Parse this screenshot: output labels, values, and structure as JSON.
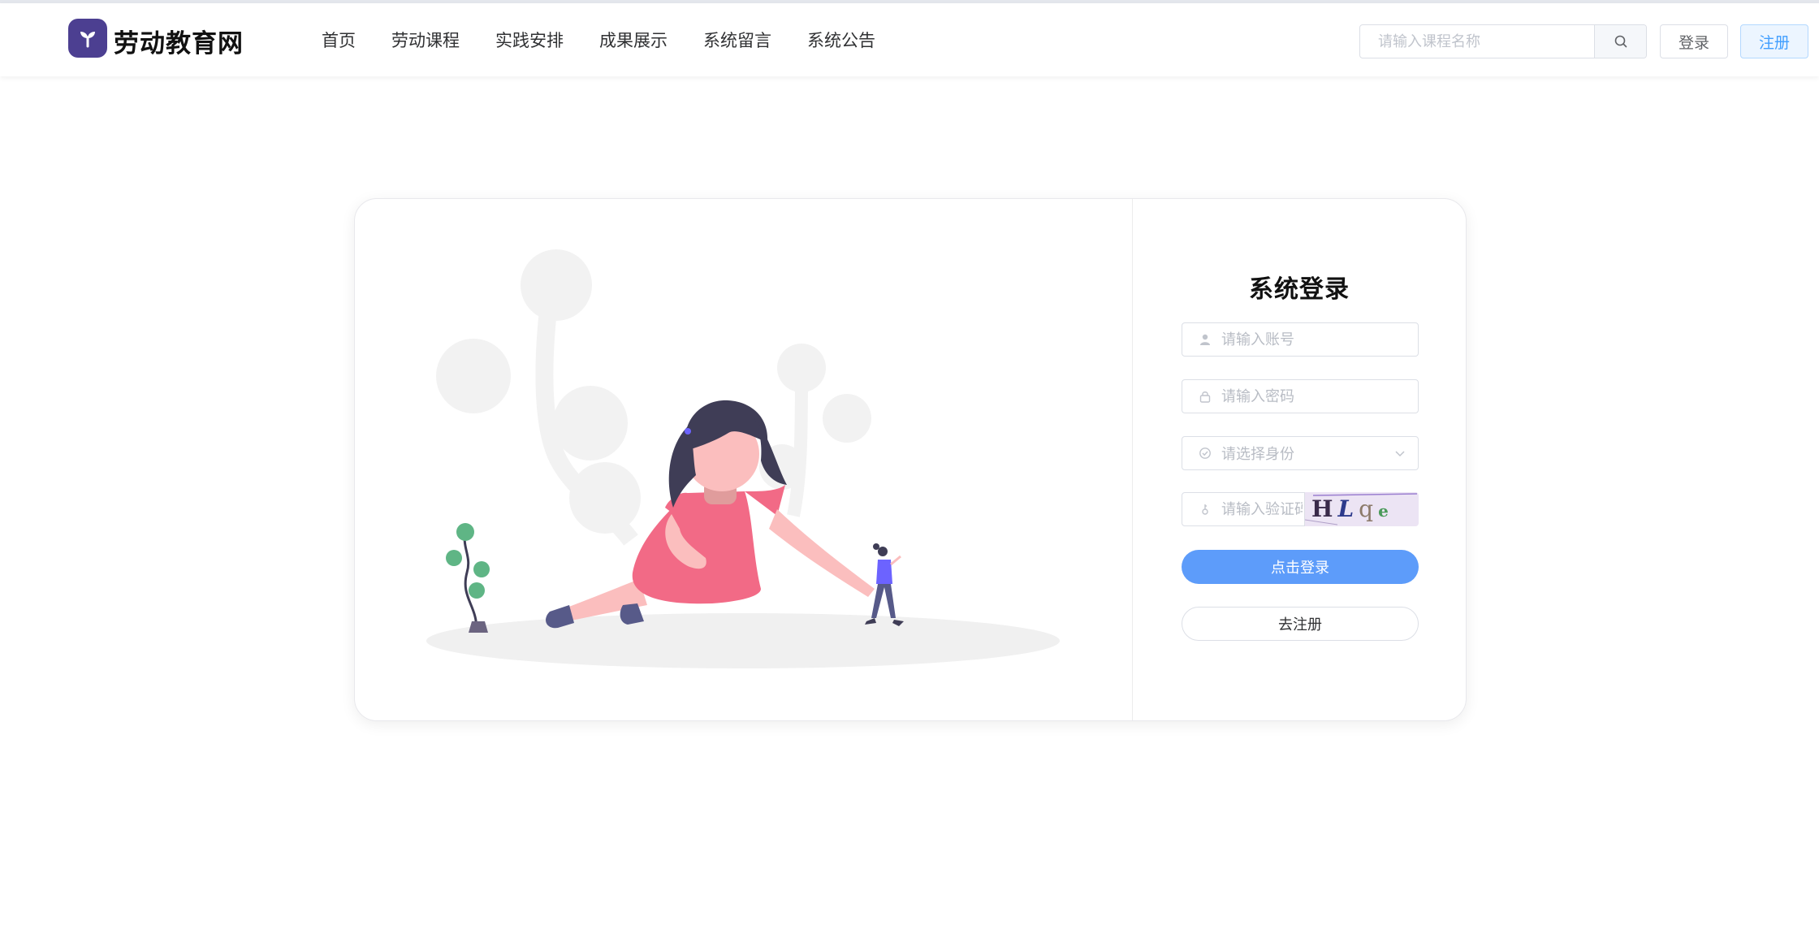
{
  "header": {
    "brand": "劳动教育网",
    "nav": [
      "首页",
      "劳动课程",
      "实践安排",
      "成果展示",
      "系统留言",
      "系统公告"
    ],
    "search_placeholder": "请输入课程名称",
    "login_label": "登录",
    "register_label": "注册"
  },
  "login": {
    "title": "系统登录",
    "account_placeholder": "请输入账号",
    "password_placeholder": "请输入密码",
    "role_placeholder": "请选择身份",
    "captcha_placeholder": "请输入验证码",
    "captcha_chars": [
      "H",
      "L",
      "q",
      "e"
    ],
    "submit_label": "点击登录",
    "goto_register_label": "去注册"
  },
  "colors": {
    "brand": "#4c3f91",
    "primary": "#5d9cfa",
    "dress": "#f26a86",
    "leaf": "#5fb585"
  },
  "icons": {
    "logo": "sprout-icon",
    "search": "search-icon",
    "account": "user-icon",
    "password": "lock-icon",
    "role": "check-circle-icon",
    "captcha": "key-icon",
    "select": "chevron-down-icon"
  }
}
